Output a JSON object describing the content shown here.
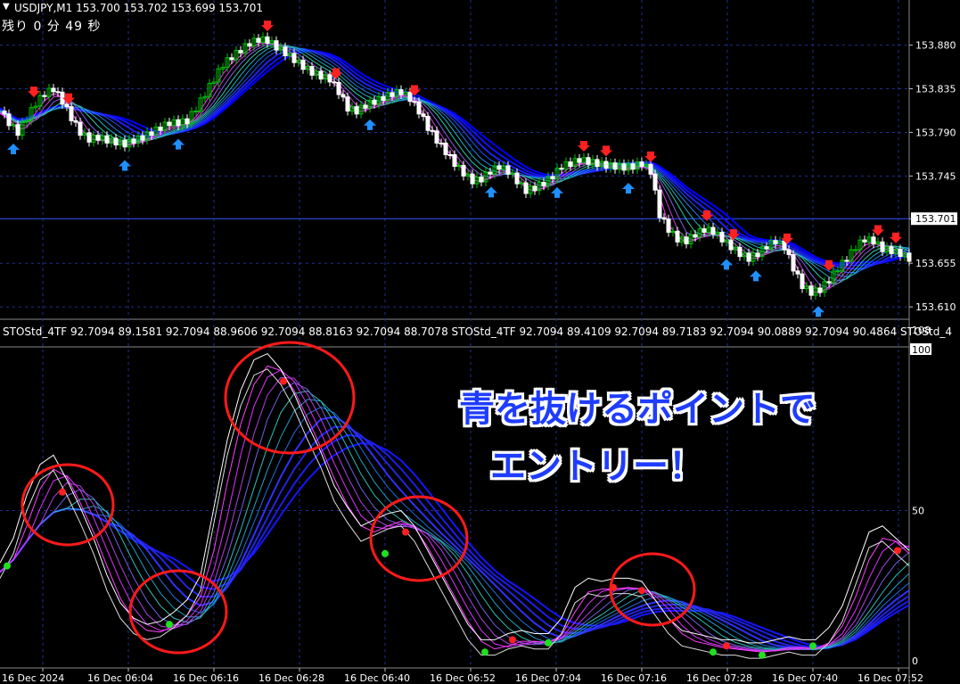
{
  "header": {
    "symbol_line": "USDJPY,M1  153.700 153.702 153.699 153.701",
    "timer": "残り 0 分 49 秒"
  },
  "indicator_header": "STOStd_4TF 92.7094 89.1581 92.7094 88.9606 92.7094 88.8163 92.7094 88.7078   STOStd_4TF 92.7094 89.4109 92.7094 89.7183 92.7094 90.0889 92.7094 90.4864   STOStd_4",
  "annotation": {
    "line1": "青を抜けるポイントで",
    "line2": "エントリー！"
  },
  "colors": {
    "background": "#000000",
    "grid": "#1f2f8f",
    "bull_candle": "#00c000",
    "bear_candle": "#ffffff",
    "sell_arrow": "#ff2020",
    "buy_arrow": "#1e90ff",
    "circle": "#ff1a1a",
    "annotation_text": "#1f3dff"
  },
  "chart_data": [
    {
      "type": "candlestick",
      "title": "USDJPY,M1",
      "price_ticks": [
        "153.880",
        "153.835",
        "153.790",
        "153.745",
        "153.701",
        "153.655",
        "153.610"
      ],
      "current_price": "153.701",
      "ylim": [
        153.6,
        153.91
      ],
      "time_labels": [
        "16 Dec 2024",
        "16 Dec 06:04",
        "16 Dec 06:16",
        "16 Dec 06:28",
        "16 Dec 06:40",
        "16 Dec 06:52",
        "16 Dec 07:04",
        "16 Dec 07:16",
        "16 Dec 07:28",
        "16 Dec 07:40",
        "16 Dec 07:52"
      ],
      "close_path": [
        [
          0,
          153.812
        ],
        [
          10,
          153.8
        ],
        [
          20,
          153.79
        ],
        [
          30,
          153.805
        ],
        [
          40,
          153.82
        ],
        [
          50,
          153.83
        ],
        [
          60,
          153.835
        ],
        [
          70,
          153.822
        ],
        [
          80,
          153.805
        ],
        [
          90,
          153.79
        ],
        [
          100,
          153.783
        ],
        [
          110,
          153.785
        ],
        [
          120,
          153.782
        ],
        [
          130,
          153.78
        ],
        [
          140,
          153.778
        ],
        [
          150,
          153.782
        ],
        [
          160,
          153.785
        ],
        [
          170,
          153.79
        ],
        [
          180,
          153.795
        ],
        [
          190,
          153.8
        ],
        [
          200,
          153.8
        ],
        [
          210,
          153.802
        ],
        [
          220,
          153.815
        ],
        [
          230,
          153.83
        ],
        [
          240,
          153.845
        ],
        [
          250,
          153.86
        ],
        [
          260,
          153.868
        ],
        [
          270,
          153.875
        ],
        [
          280,
          153.882
        ],
        [
          290,
          153.886
        ],
        [
          300,
          153.885
        ],
        [
          310,
          153.878
        ],
        [
          320,
          153.872
        ],
        [
          330,
          153.865
        ],
        [
          340,
          153.858
        ],
        [
          350,
          153.852
        ],
        [
          360,
          153.848
        ],
        [
          370,
          153.845
        ],
        [
          380,
          153.832
        ],
        [
          390,
          153.815
        ],
        [
          400,
          153.812
        ],
        [
          410,
          153.818
        ],
        [
          420,
          153.822
        ],
        [
          430,
          153.826
        ],
        [
          440,
          153.83
        ],
        [
          450,
          153.832
        ],
        [
          460,
          153.825
        ],
        [
          470,
          153.812
        ],
        [
          480,
          153.795
        ],
        [
          490,
          153.782
        ],
        [
          500,
          153.77
        ],
        [
          510,
          153.758
        ],
        [
          520,
          153.748
        ],
        [
          530,
          153.74
        ],
        [
          540,
          153.742
        ],
        [
          550,
          153.75
        ],
        [
          560,
          153.755
        ],
        [
          570,
          153.75
        ],
        [
          580,
          153.74
        ],
        [
          590,
          153.73
        ],
        [
          600,
          153.733
        ],
        [
          610,
          153.738
        ],
        [
          620,
          153.745
        ],
        [
          630,
          153.755
        ],
        [
          640,
          153.758
        ],
        [
          650,
          153.762
        ],
        [
          660,
          153.76
        ],
        [
          670,
          153.758
        ],
        [
          680,
          153.756
        ],
        [
          690,
          153.755
        ],
        [
          700,
          153.754
        ],
        [
          710,
          153.755
        ],
        [
          720,
          153.758
        ],
        [
          730,
          153.75
        ],
        [
          740,
          153.705
        ],
        [
          750,
          153.69
        ],
        [
          760,
          153.68
        ],
        [
          770,
          153.678
        ],
        [
          780,
          153.685
        ],
        [
          790,
          153.69
        ],
        [
          800,
          153.688
        ],
        [
          810,
          153.68
        ],
        [
          820,
          153.672
        ],
        [
          830,
          153.665
        ],
        [
          840,
          153.66
        ],
        [
          850,
          153.665
        ],
        [
          860,
          153.673
        ],
        [
          870,
          153.678
        ],
        [
          880,
          153.672
        ],
        [
          890,
          153.65
        ],
        [
          900,
          153.632
        ],
        [
          910,
          153.625
        ],
        [
          920,
          153.628
        ],
        [
          930,
          153.638
        ],
        [
          940,
          153.65
        ],
        [
          950,
          153.66
        ],
        [
          960,
          153.672
        ],
        [
          970,
          153.68
        ],
        [
          980,
          153.678
        ],
        [
          990,
          153.67
        ],
        [
          1000,
          153.668
        ],
        [
          1010,
          153.665
        ],
        [
          1020,
          153.66
        ]
      ]
    },
    {
      "type": "line",
      "title": "STOStd_4TF",
      "y_ticks": [
        "108",
        "100",
        "50",
        "0"
      ],
      "ylim": [
        0,
        108
      ],
      "oscillator_path": [
        [
          0,
          30
        ],
        [
          15,
          38
        ],
        [
          30,
          52
        ],
        [
          45,
          62
        ],
        [
          60,
          65
        ],
        [
          75,
          57
        ],
        [
          90,
          48
        ],
        [
          105,
          38
        ],
        [
          120,
          26
        ],
        [
          135,
          17
        ],
        [
          150,
          12
        ],
        [
          165,
          10
        ],
        [
          180,
          11
        ],
        [
          195,
          14
        ],
        [
          210,
          18
        ],
        [
          225,
          26
        ],
        [
          240,
          48
        ],
        [
          255,
          70
        ],
        [
          270,
          86
        ],
        [
          285,
          96
        ],
        [
          300,
          98
        ],
        [
          315,
          93
        ],
        [
          330,
          85
        ],
        [
          345,
          75
        ],
        [
          360,
          66
        ],
        [
          375,
          55
        ],
        [
          390,
          48
        ],
        [
          405,
          42
        ],
        [
          420,
          44
        ],
        [
          435,
          46
        ],
        [
          450,
          47
        ],
        [
          465,
          42
        ],
        [
          480,
          34
        ],
        [
          495,
          26
        ],
        [
          510,
          18
        ],
        [
          525,
          10
        ],
        [
          540,
          5
        ],
        [
          555,
          5
        ],
        [
          570,
          7
        ],
        [
          585,
          8
        ],
        [
          600,
          7
        ],
        [
          615,
          7
        ],
        [
          630,
          12
        ],
        [
          645,
          22
        ],
        [
          660,
          25
        ],
        [
          675,
          24
        ],
        [
          690,
          25
        ],
        [
          705,
          25
        ],
        [
          720,
          24
        ],
        [
          735,
          18
        ],
        [
          750,
          12
        ],
        [
          765,
          8
        ],
        [
          780,
          7
        ],
        [
          795,
          6
        ],
        [
          810,
          5
        ],
        [
          825,
          5
        ],
        [
          840,
          4
        ],
        [
          855,
          4
        ],
        [
          870,
          5
        ],
        [
          885,
          6
        ],
        [
          900,
          5
        ],
        [
          915,
          5
        ],
        [
          930,
          9
        ],
        [
          945,
          16
        ],
        [
          960,
          28
        ],
        [
          975,
          40
        ],
        [
          990,
          42
        ],
        [
          1005,
          38
        ],
        [
          1020,
          34
        ]
      ],
      "red_dots": [
        [
          70,
          56
        ],
        [
          318,
          92
        ],
        [
          455,
          43
        ],
        [
          575,
          8
        ],
        [
          688,
          25
        ],
        [
          720,
          24
        ],
        [
          815,
          6
        ],
        [
          1007,
          37
        ]
      ],
      "green_dots": [
        [
          8,
          32
        ],
        [
          190,
          13
        ],
        [
          432,
          36
        ],
        [
          544,
          4
        ],
        [
          615,
          7
        ],
        [
          800,
          4
        ],
        [
          855,
          3
        ],
        [
          912,
          6
        ]
      ]
    }
  ],
  "marks": {
    "sell_arrows_x": [
      38,
      77,
      300,
      377,
      465,
      655,
      680,
      730,
      793,
      823,
      883,
      930,
      985,
      1005
    ],
    "buy_arrows_x": [
      15,
      140,
      200,
      415,
      551,
      625,
      705,
      815,
      848,
      918
    ],
    "circles": [
      {
        "cx": 76,
        "cy": 566,
        "rx": 51,
        "ry": 45
      },
      {
        "cx": 200,
        "cy": 686,
        "rx": 54,
        "ry": 46
      },
      {
        "cx": 325,
        "cy": 446,
        "rx": 72,
        "ry": 62
      },
      {
        "cx": 470,
        "cy": 604,
        "rx": 54,
        "ry": 47
      },
      {
        "cx": 732,
        "cy": 661,
        "rx": 47,
        "ry": 40
      }
    ]
  }
}
